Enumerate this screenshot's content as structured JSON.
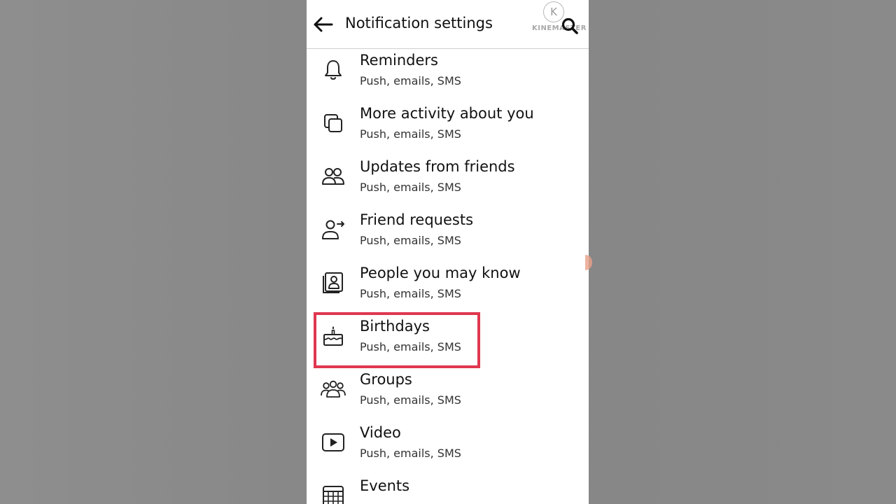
{
  "header": {
    "title": "Notification settings",
    "back_icon": "arrow-left-icon",
    "search_icon": "search-icon",
    "watermark": {
      "letter": "K",
      "text": "KINEMASTER"
    }
  },
  "items": [
    {
      "label": "Reminders",
      "sub": "Push, emails, SMS",
      "icon": "bell-icon"
    },
    {
      "label": "More activity about you",
      "sub": "Push, emails, SMS",
      "icon": "stacked-squares-icon"
    },
    {
      "label": "Updates from friends",
      "sub": "Push, emails, SMS",
      "icon": "two-people-icon"
    },
    {
      "label": "Friend requests",
      "sub": "Push, emails, SMS",
      "icon": "person-arrow-icon"
    },
    {
      "label": "People you may know",
      "sub": "Push, emails, SMS",
      "icon": "contact-card-icon"
    },
    {
      "label": "Birthdays",
      "sub": "Push, emails, SMS",
      "icon": "birthday-cake-icon",
      "highlighted": true
    },
    {
      "label": "Groups",
      "sub": "Push, emails, SMS",
      "icon": "group-icon"
    },
    {
      "label": "Video",
      "sub": "Push, emails, SMS",
      "icon": "play-icon"
    },
    {
      "label": "Events",
      "sub": "",
      "icon": "calendar-icon"
    }
  ],
  "colors": {
    "highlight_border": "#e0374f",
    "background": "#888888",
    "panel": "#ffffff"
  }
}
